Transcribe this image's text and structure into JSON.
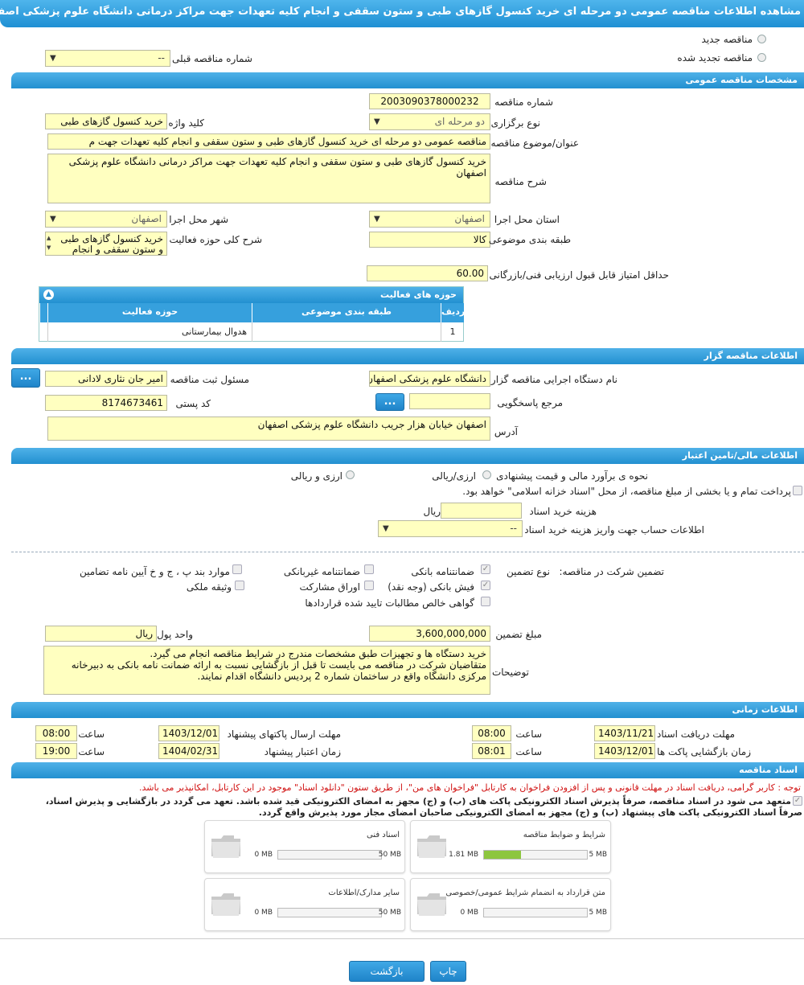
{
  "title": "مشاهده اطلاعات مناقصه عمومی دو مرحله ای خرید کنسول گازهای طبی و ستون سقفی و انجام کلیه تعهدات جهت مراکز درمانی دانشگاه علوم پزشکی اصفهان",
  "top": {
    "new_tender": "مناقصه جدید",
    "renewed_tender": "مناقصه تجدید شده",
    "prev_number_label": "شماره مناقصه قبلی",
    "prev_number_value": "--"
  },
  "general": {
    "header": "مشخصات مناقصه عمومی",
    "number_label": "شماره مناقصه",
    "number": "2003090378000232",
    "type_label": "نوع برگزاری",
    "type": "دو مرحله ای",
    "keyword_label": "کلید واژه",
    "keyword": "خرید کنسول گازهای طبی",
    "subject_label": "عنوان/موضوع مناقصه",
    "subject": "مناقصه عمومی دو مرحله ای خرید کنسول گازهای طبی و ستون سقفی و انجام کلیه تعهدات جهت م",
    "desc_label": "شرح مناقصه",
    "desc": "خرید کنسول گازهای طبی و ستون سقفی و انجام کلیه تعهدات جهت مراکز درمانی دانشگاه علوم پزشکی اصفهان",
    "province_label": "استان محل اجرا",
    "province": "اصفهان",
    "city_label": "شهر محل اجرا",
    "city": "اصفهان",
    "category_label": "طبقه بندی موضوعی",
    "category": "کالا",
    "scope_label": "شرح کلی حوزه فعالیت",
    "scope": "خرید کنسول گازهای طبی و ستون سقفی و انجام",
    "min_score_label": "حداقل امتیاز قابل قبول ارزیابی فنی/بازرگانی",
    "min_score": "60.00"
  },
  "activity": {
    "header": "حوزه های فعالیت",
    "col_row": "ردیف",
    "col_category": "طبقه بندی موضوعی",
    "col_field": "حوزه فعالیت",
    "rows": [
      {
        "n": "1",
        "category": "",
        "field": "هدوال بیمارستانی"
      }
    ]
  },
  "organizer": {
    "header": "اطلاعات مناقصه گزار",
    "org_label": "نام دستگاه اجرایی مناقصه گزار",
    "org": "دانشگاه علوم پزشکی اصفهان",
    "resp_label": "مسئول ثبت مناقصه",
    "resp": "امیر جان نثاری لادانی",
    "ref_label": "مرجع پاسخگویی",
    "ref": "",
    "postal_label": "کد پستی",
    "postal": "8174673461",
    "address_label": "آدرس",
    "address": "اصفهان خیابان هزار جریب دانشگاه علوم پزشکی اصفهان",
    "dots": "..."
  },
  "finance": {
    "header": "اطلاعات مالی/تامین اعتبار",
    "estimate_label": "نحوه ی برآورد مالی و قیمت پیشنهادی",
    "opt_rial_currency": "ارزی/ریالی",
    "opt_currency_rial": "ارزی و ریالی",
    "treasury_text": "پرداخت تمام و یا بخشی از مبلغ مناقصه، از محل \"اسناد خزانه اسلامی\" خواهد بود.",
    "doc_fee_label": "هزینه خرید اسناد",
    "doc_fee": "",
    "rial": "ریال",
    "account_label": "اطلاعات حساب جهت واریز هزینه خرید اسناد",
    "account": "--"
  },
  "guarantee": {
    "label": "تضمین شرکت در مناقصه:",
    "type_label": "نوع تضمین",
    "bank_guarantee": "ضمانتنامه بانکی",
    "nonbank_guarantee": "ضمانتنامه غیربانکی",
    "items_bpj": "موارد بند پ ، ج و خ آیین نامه تضامین",
    "bank_receipt": "فیش بانکی (وجه نقد)",
    "participation_bonds": "اوراق مشارکت",
    "property": "وثیقه ملکی",
    "net_claims": "گواهی خالص مطالبات تایید شده قراردادها",
    "amount_label": "مبلغ تضمین",
    "amount": "3,600,000,000",
    "unit_label": "واحد پول",
    "unit": "ریال",
    "notes_label": "توضیحات",
    "notes": "خرید دستگاه ها و تجهیزات طبق مشخصات مندرج در شرایط مناقصه انجام می گیرد.\nمتقاضیان شرکت در مناقصه می بایست تا قبل از بازگشایی نسبت به ارائه ضمانت نامه بانکی به دبیرخانه مرکزی دانشگاه واقع در ساختمان شماره 2 پردیس دانشگاه اقدام نمایند."
  },
  "timing": {
    "header": "اطلاعات زمانی",
    "receive_label": "مهلت دریافت اسناد",
    "receive_date": "1403/11/21",
    "receive_time": "08:00",
    "send_label": "مهلت ارسال پاکتهای پیشنهاد",
    "send_date": "1403/12/01",
    "send_time": "08:00",
    "open_label": "زمان بازگشایی پاکت ها",
    "open_date": "1403/12/01",
    "open_time": "08:01",
    "valid_label": "زمان اعتبار پیشنهاد",
    "valid_date": "1404/02/31",
    "valid_time": "19:00",
    "time_label": "ساعت"
  },
  "docs": {
    "header": "اسناد مناقصه",
    "notice": "توجه : کاربر گرامی، دریافت اسناد در مهلت قانونی و پس از افزودن فراخوان به کارتابل \"فراخوان های من\"، از طریق ستون \"دانلود اسناد\" موجود در این کارتابل، امکانپذیر می باشد.",
    "commit1": "متعهد می شود در اسناد مناقصه، صرفاً پذیرش اسناد الکترونیکی پاکت های (ب) و (ج) مجهز به امضای الکترونیکی قید شده باشد. تعهد می گردد در بازگشایی و پذیرش اسناد،",
    "commit2": "صرفاً اسناد الکترونیکی پاکت های پیشنهاد (ب) و (ج) مجهز به امضای الکترونیکی صاحبان امضای مجاز مورد پذیرش واقع گردد.",
    "cards": [
      {
        "name": "شرایط و ضوابط مناقصه",
        "current": "1.81 MB",
        "max": "5 MB",
        "fill": 0.36
      },
      {
        "name": "اسناد فنی",
        "current": "0 MB",
        "max": "50 MB",
        "fill": 0
      },
      {
        "name": "متن قرارداد به انضمام شرایط عمومی/خصوصی",
        "current": "0 MB",
        "max": "5 MB",
        "fill": 0
      },
      {
        "name": "سایر مدارک/اطلاعات",
        "current": "0 MB",
        "max": "50 MB",
        "fill": 0
      }
    ]
  },
  "buttons": {
    "print": "چاپ",
    "back": "بازگشت"
  },
  "colors": {
    "header_blue": "#2290d0",
    "field_yellow": "#ffffc0",
    "progress_green": "#8dc63f",
    "notice_red": "#d01010"
  }
}
